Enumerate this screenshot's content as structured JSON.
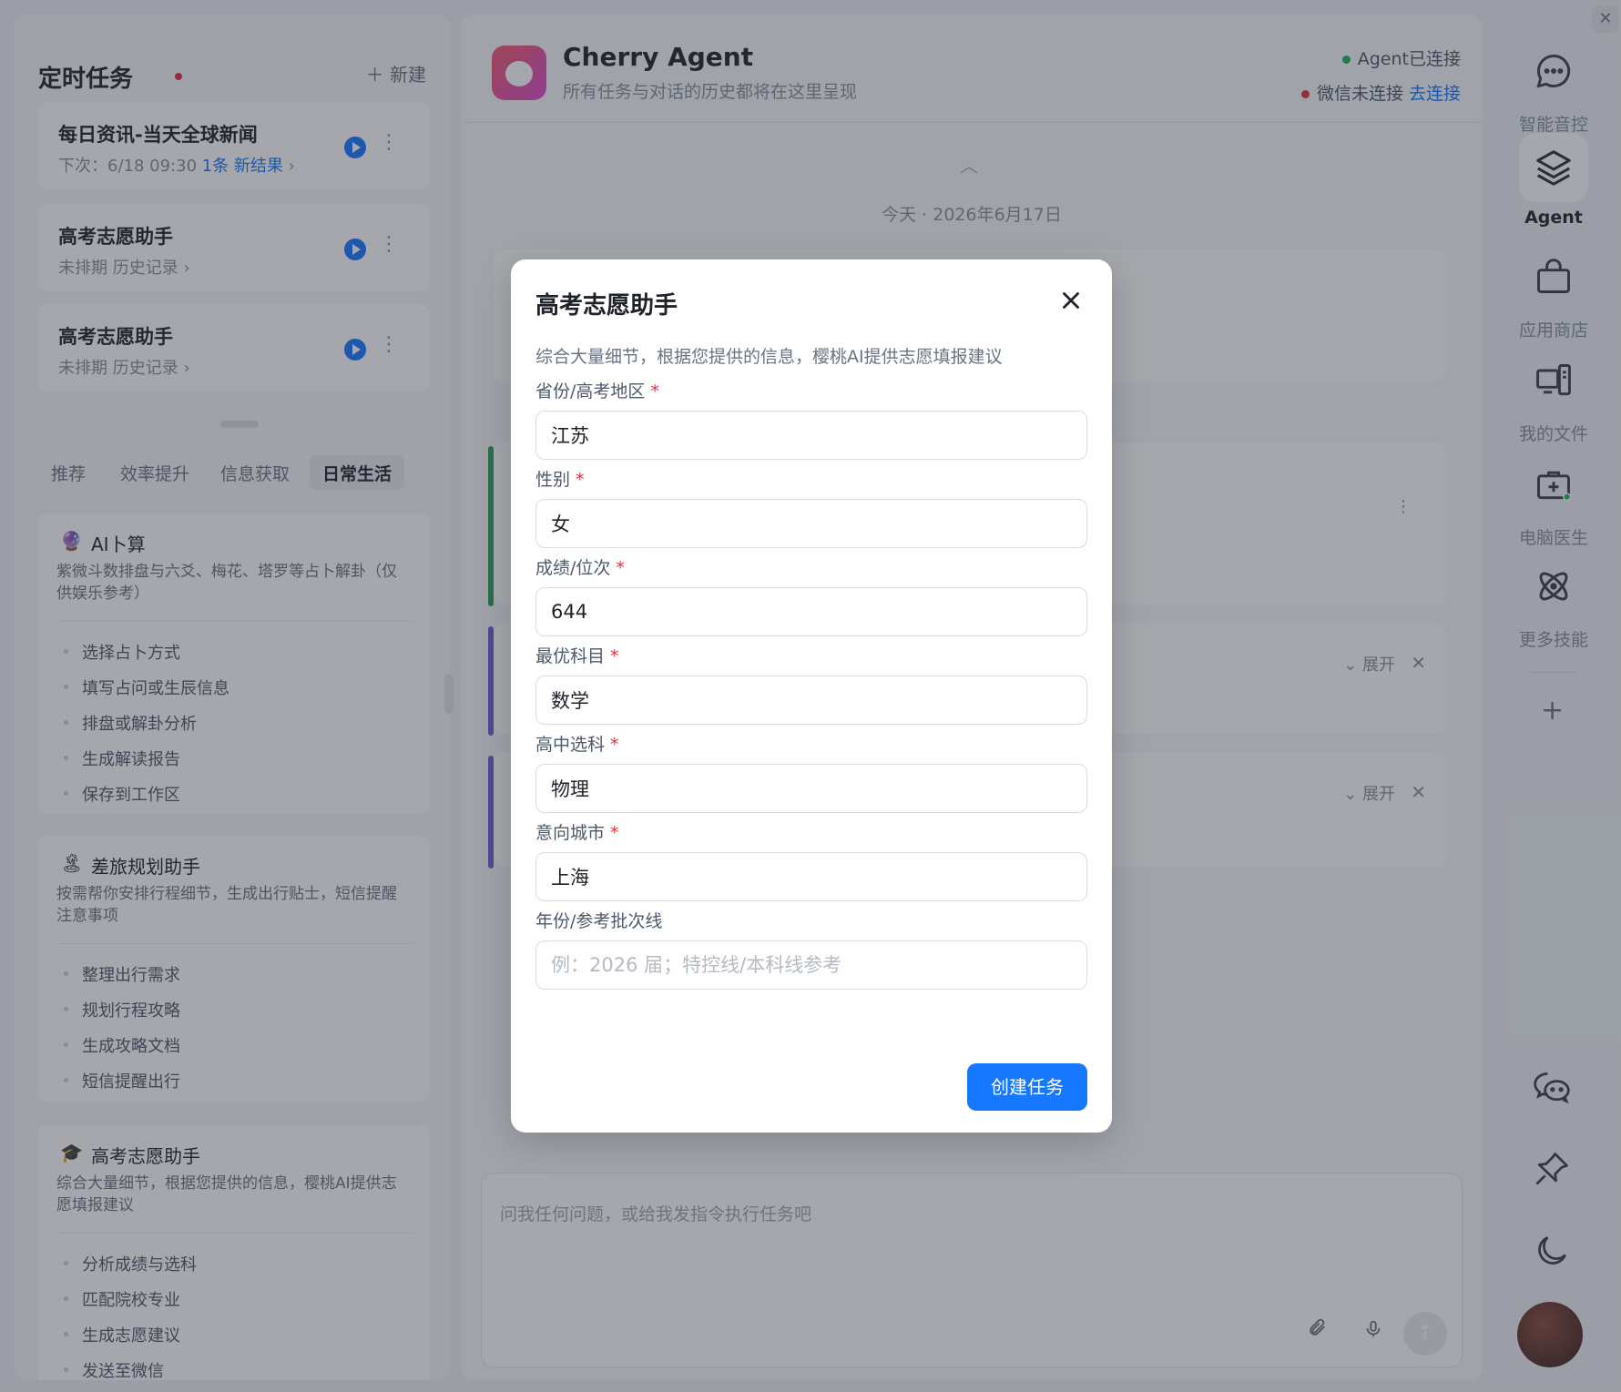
{
  "left_panel": {
    "title": "定时任务",
    "new_button": "＋ 新建",
    "tasks": [
      {
        "title": "每日资讯-当天全球新闻",
        "next": "下次：6/18 09:30",
        "link": "1条 新结果",
        "chevron": "›"
      },
      {
        "title": "高考志愿助手",
        "next": "未排期",
        "link": "历史记录",
        "chevron": "›"
      },
      {
        "title": "高考志愿助手",
        "next": "未排期",
        "link": "历史记录",
        "chevron": "›"
      }
    ],
    "tabs": [
      "推荐",
      "效率提升",
      "信息获取",
      "日常生活"
    ],
    "active_tab": "日常生活",
    "skills": [
      {
        "emoji": "🔮",
        "name": "AI卜算",
        "desc": "紫微斗数排盘与六爻、梅花、塔罗等占卜解卦（仅供娱乐参考）",
        "steps": [
          "选择占卜方式",
          "填写占问或生辰信息",
          "排盘或解卦分析",
          "生成解读报告",
          "保存到工作区"
        ]
      },
      {
        "emoji": "🏝",
        "name": "差旅规划助手",
        "desc": "按需帮你安排行程细节，生成出行贴士，短信提醒注意事项",
        "steps": [
          "整理出行需求",
          "规划行程攻略",
          "生成攻略文档",
          "短信提醒出行"
        ]
      },
      {
        "emoji": "🎓",
        "name": "高考志愿助手",
        "desc": "综合大量细节，根据您提供的信息，樱桃AI提供志愿填报建议",
        "steps": [
          "分析成绩与选科",
          "匹配院校专业",
          "生成志愿建议",
          "发送至微信"
        ]
      }
    ]
  },
  "main": {
    "agent_name": "Cherry Agent",
    "agent_desc": "所有任务与对话的历史都将在这里呈现",
    "status_agent": "Agent已连接",
    "status_wechat": "微信未连接",
    "wechat_link": "去连接",
    "date_label": "今天 · 2026年6月17日",
    "expand_label": "展开",
    "composer_placeholder": "问我任何问题，或给我发指令执行任务吧"
  },
  "rail": {
    "items": [
      {
        "label": "智能音控",
        "icon": "chat-bubble-icon"
      },
      {
        "label": "Agent",
        "icon": "layers-icon"
      },
      {
        "label": "应用商店",
        "icon": "shopping-bag-icon"
      },
      {
        "label": "我的文件",
        "icon": "files-icon"
      },
      {
        "label": "电脑医生",
        "icon": "medkit-icon"
      },
      {
        "label": "更多技能",
        "icon": "atom-icon"
      }
    ],
    "active": "Agent"
  },
  "modal": {
    "title": "高考志愿助手",
    "desc": "综合大量细节，根据您提供的信息，樱桃AI提供志愿填报建议",
    "fields": [
      {
        "label": "省份/高考地区",
        "required": true,
        "value": "江苏",
        "placeholder": ""
      },
      {
        "label": "性别",
        "required": true,
        "value": "女",
        "placeholder": ""
      },
      {
        "label": "成绩/位次",
        "required": true,
        "value": "644",
        "placeholder": ""
      },
      {
        "label": "最优科目",
        "required": true,
        "value": "数学",
        "placeholder": ""
      },
      {
        "label": "高中选科",
        "required": true,
        "value": "物理",
        "placeholder": ""
      },
      {
        "label": "意向城市",
        "required": true,
        "value": "上海",
        "placeholder": ""
      },
      {
        "label": "年份/参考批次线",
        "required": false,
        "value": "",
        "placeholder": "例：2026 届；特控线/本科线参考"
      }
    ],
    "required_mark": "*",
    "submit": "创建任务"
  },
  "colors": {
    "accent": "#1677ff",
    "required": "#e0313e",
    "online": "#20b25a"
  }
}
